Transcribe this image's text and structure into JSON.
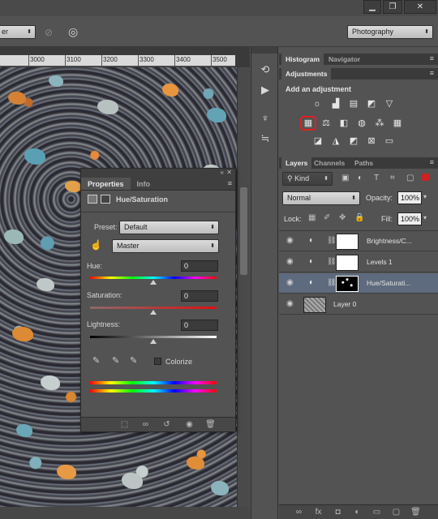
{
  "window_controls": {
    "minimize": "▁",
    "restore": "❐",
    "close": "✕"
  },
  "options_bar": {
    "left_dropdown": "er",
    "workspace": "Photography"
  },
  "ruler": {
    "labels": [
      "3000",
      "3100",
      "3200",
      "3300",
      "3400",
      "3500"
    ]
  },
  "properties_panel": {
    "tabs": [
      "Properties",
      "Info"
    ],
    "title": "Hue/Saturation",
    "preset_label": "Preset:",
    "preset_value": "Default",
    "channel_value": "Master",
    "hue_label": "Hue:",
    "hue_value": "0",
    "saturation_label": "Saturation:",
    "saturation_value": "0",
    "lightness_label": "Lightness:",
    "lightness_value": "0",
    "colorize_label": "Colorize",
    "colorize_checked": false
  },
  "top_panel_tabs": [
    "Histogram",
    "Navigator"
  ],
  "adjustments": {
    "tab": "Adjustments",
    "heading": "Add an adjustment",
    "row1": [
      "brightness-contrast-icon",
      "levels-icon",
      "curves-icon",
      "exposure-icon",
      "triangle-icon"
    ],
    "row2": [
      "hue-saturation-icon",
      "color-balance-icon",
      "black-white-icon",
      "photo-filter-icon",
      "channel-mixer-icon",
      "color-lookup-icon"
    ],
    "row3": [
      "invert-icon",
      "posterize-icon",
      "threshold-icon",
      "selective-color-icon",
      "gradient-map-icon"
    ],
    "highlight_color": "#e02020"
  },
  "layers_panel": {
    "tabs": [
      "Layers",
      "Channels",
      "Paths"
    ],
    "filter_label": "Kind",
    "blend_mode": "Normal",
    "opacity_label": "Opacity:",
    "opacity_value": "100%",
    "lock_label": "Lock:",
    "fill_label": "Fill:",
    "fill_value": "100%",
    "layers": [
      {
        "name": "Brightness/C...",
        "selected": false
      },
      {
        "name": "Levels 1",
        "selected": false
      },
      {
        "name": "Hue/Saturati...",
        "selected": true
      },
      {
        "name": "Layer 0",
        "selected": false
      }
    ],
    "selected_color": "#5e6a7d"
  }
}
